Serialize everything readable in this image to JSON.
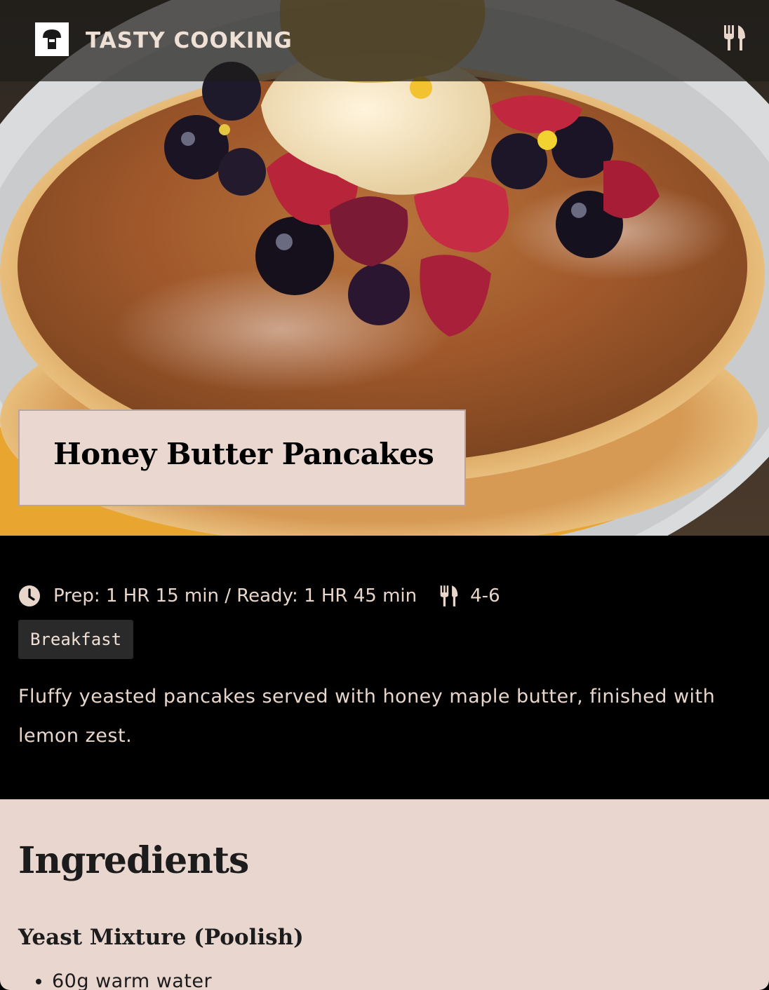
{
  "header": {
    "brand": "TASTY COOKING",
    "logo_icon": "mushroom-logo-icon",
    "menu_icon": "fork-knife-icon"
  },
  "hero": {
    "image_alt": "Honey Butter Pancakes",
    "title": "Honey Butter Pancakes"
  },
  "meta": {
    "time_icon": "clock-icon",
    "time_text": "Prep: 1 HR 15 min / Ready: 1 HR 45 min",
    "servings_icon": "fork-knife-icon",
    "servings": "4-6",
    "tag": "Breakfast",
    "description": "Fluffy yeasted pancakes served with honey maple butter, finished with lemon zest."
  },
  "ingredients": {
    "heading": "Ingredients",
    "groups": [
      {
        "title": "Yeast Mixture (Poolish)",
        "items": [
          "60g warm water"
        ]
      }
    ]
  },
  "colors": {
    "cream": "#e9d7cf",
    "text_light": "#e8d6cb",
    "tag_bg": "#2a2a2a",
    "background": "#000000"
  }
}
